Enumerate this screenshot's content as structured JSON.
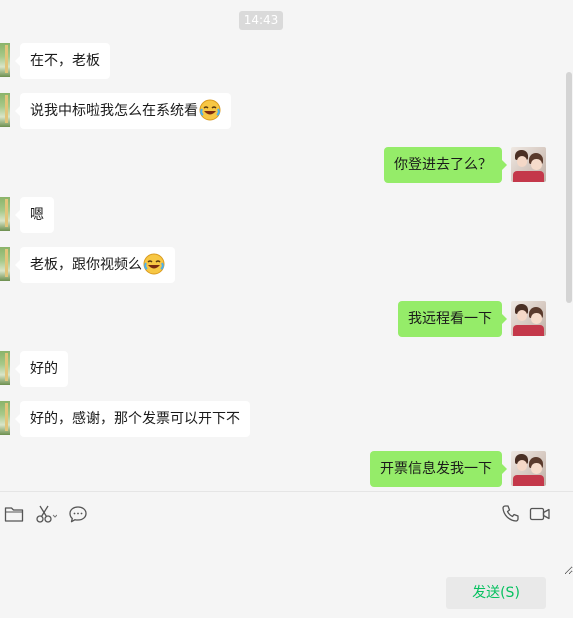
{
  "chat": {
    "timestamp": "14:43",
    "messages": [
      {
        "side": "left",
        "text": "在不，老板"
      },
      {
        "side": "left",
        "text": "说我中标啦我怎么在系统看",
        "emoji": "laughing-crying-emoji"
      },
      {
        "side": "right",
        "text": "你登进去了么？"
      },
      {
        "side": "left",
        "text": "嗯"
      },
      {
        "side": "left",
        "text": "老板，跟你视频么",
        "emoji": "laughing-crying-emoji"
      },
      {
        "side": "right",
        "text": "我远程看一下"
      },
      {
        "side": "left",
        "text": "好的"
      },
      {
        "side": "left",
        "text": "好的，感谢，那个发票可以开下不"
      },
      {
        "side": "right",
        "text": "开票信息发我一下"
      }
    ]
  },
  "toolbar": {
    "left_icons": [
      "folder-icon",
      "scissors-icon",
      "chat-bubble-icon"
    ],
    "right_icons": [
      "phone-icon",
      "video-camera-icon"
    ]
  },
  "input": {
    "value": ""
  },
  "send_button": {
    "label": "发送(S)"
  },
  "colors": {
    "background": "#f5f5f5",
    "incoming_bubble": "#ffffff",
    "outgoing_bubble": "#95ec69",
    "send_text": "#07c160"
  }
}
